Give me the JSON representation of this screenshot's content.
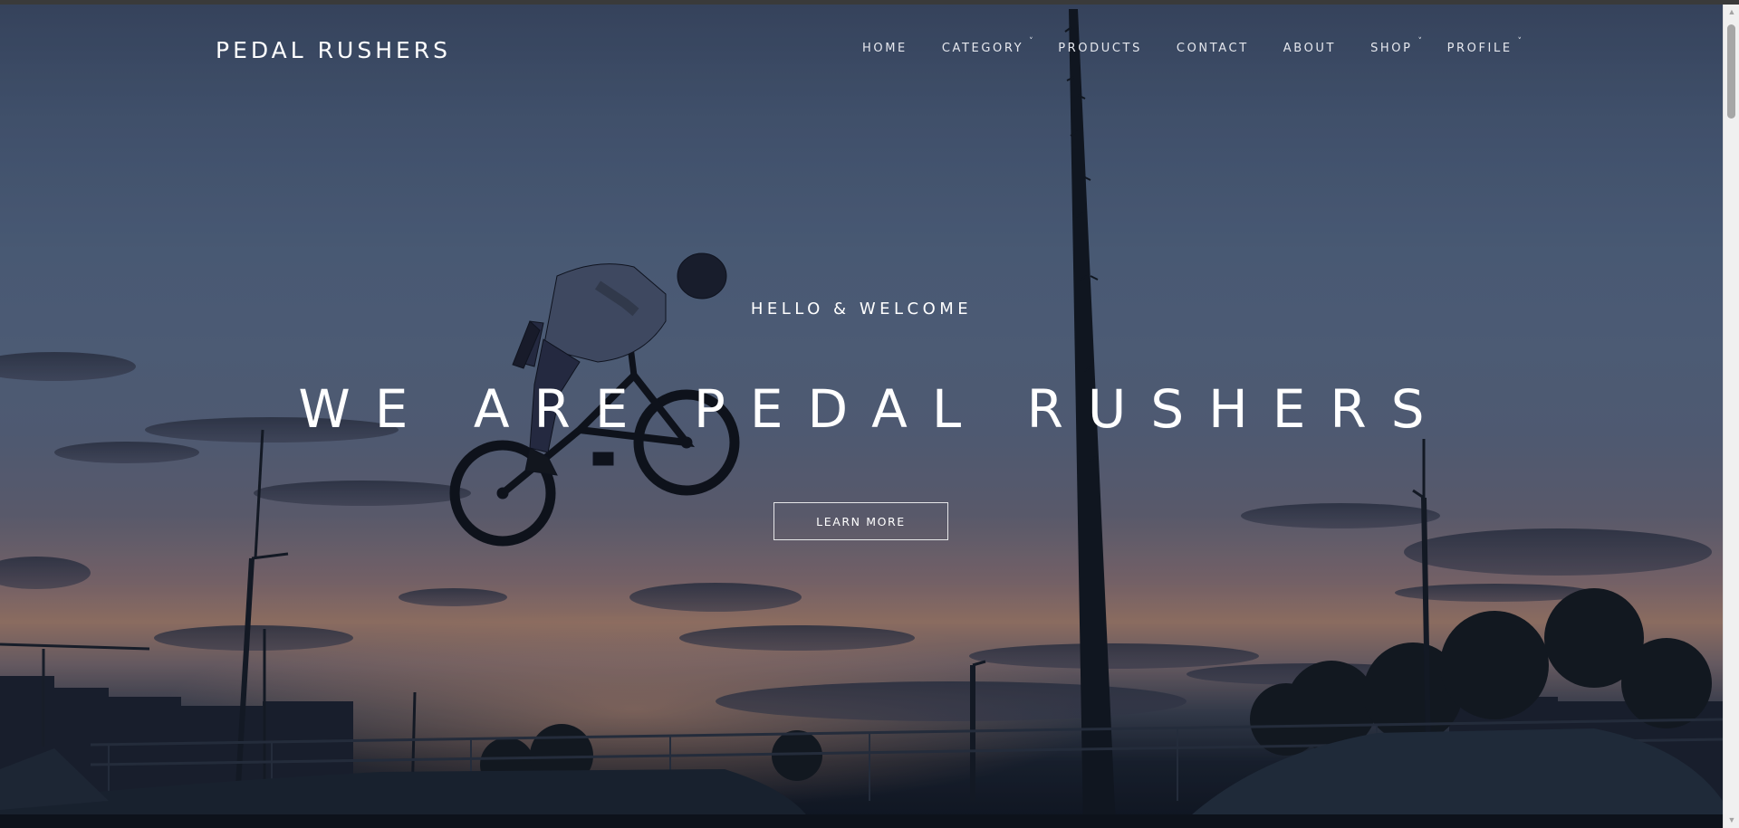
{
  "brand": {
    "name": "PEDAL RUSHERS"
  },
  "nav": {
    "items": [
      {
        "label": "HOME",
        "dropdown": false
      },
      {
        "label": "CATEGORY",
        "dropdown": true
      },
      {
        "label": "PRODUCTS",
        "dropdown": false
      },
      {
        "label": "CONTACT",
        "dropdown": false
      },
      {
        "label": "ABOUT",
        "dropdown": false
      },
      {
        "label": "SHOP",
        "dropdown": true
      },
      {
        "label": "PROFILE",
        "dropdown": true
      }
    ],
    "chevron": "˅"
  },
  "hero": {
    "greeting": "HELLO & WELCOME",
    "headline": "WE ARE PEDAL RUSHERS",
    "cta_label": "LEARN MORE"
  },
  "icons": {
    "dropdown": "chevron-down-icon",
    "scroll_up": "scroll-up-arrow-icon",
    "scroll_down": "scroll-down-arrow-icon"
  },
  "colors": {
    "text": "#ffffff",
    "sky_top": "#3f4e6a",
    "sunset": "#a7806f"
  }
}
